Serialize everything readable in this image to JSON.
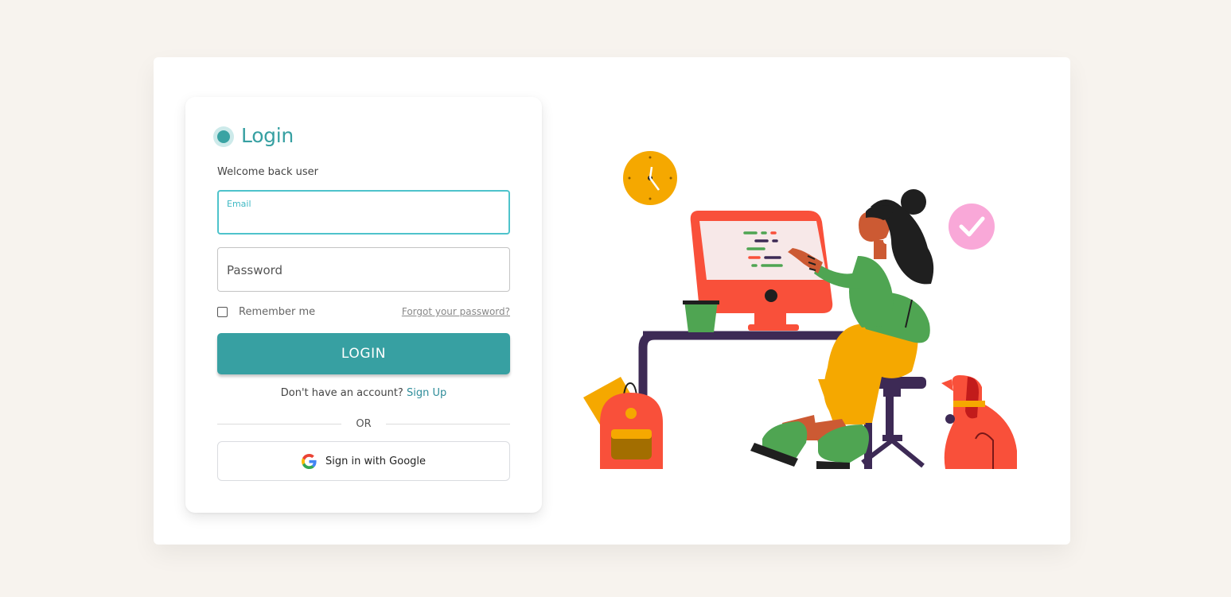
{
  "login": {
    "title": "Login",
    "welcome": "Welcome back user",
    "email": {
      "label": "Email",
      "value": ""
    },
    "password": {
      "placeholder": "Password"
    },
    "remember_label": "Remember me",
    "forgot_label": "Forgot your password?",
    "login_button": "LOGIN",
    "signup_prompt": "Don't have an account?",
    "signup_link": "Sign Up",
    "divider": "OR",
    "google_button": "Sign in with Google"
  },
  "colors": {
    "background": "#f7f3ee",
    "accent": "#37a0a2",
    "input_focus": "#4ec3cb",
    "link": "#2f8d9a"
  },
  "icons": {
    "logo": "circle-logo-icon",
    "google": "google-g-icon"
  }
}
